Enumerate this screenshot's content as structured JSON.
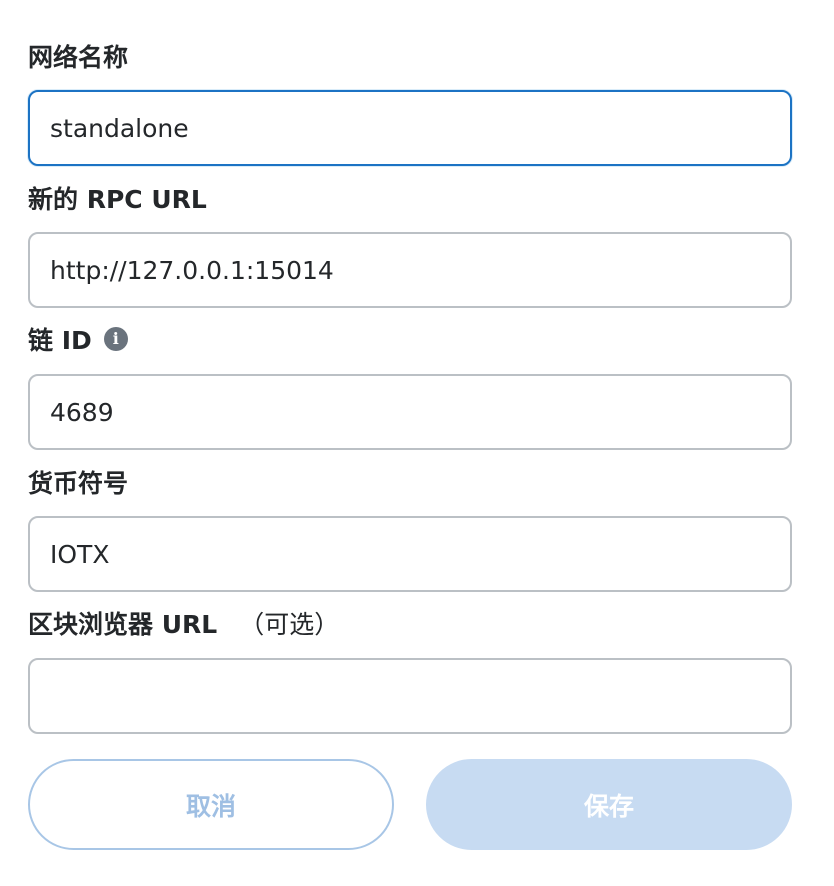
{
  "fields": [
    {
      "label": "网络名称",
      "value": "standalone",
      "placeholder": ""
    },
    {
      "label": "新的 RPC URL",
      "value": "http://127.0.0.1:15014",
      "placeholder": ""
    },
    {
      "label": "链 ID",
      "value": "4689",
      "placeholder": "",
      "info_icon": "info-icon"
    },
    {
      "label": "货币符号",
      "value": "IOTX",
      "placeholder": ""
    },
    {
      "label": "区块浏览器 URL",
      "optional": "（可选）",
      "value": "",
      "placeholder": ""
    }
  ],
  "buttons": {
    "cancel": "取消",
    "save": "保存"
  },
  "colors": {
    "focus_border": "#1c73c4",
    "border": "#bbc0c5",
    "text": "#24272a",
    "cancel_border": "#a8c6e6",
    "save_background": "#c7dbf2"
  }
}
